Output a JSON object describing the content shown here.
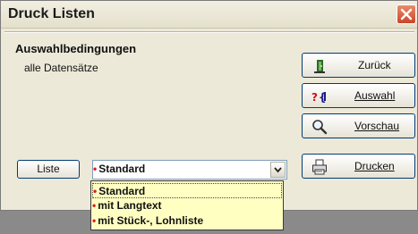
{
  "window": {
    "title": "Druck Listen"
  },
  "section": {
    "heading": "Auswahlbedingungen",
    "condition": "alle Datensätze"
  },
  "buttons": {
    "back": "Zurück",
    "select": "Auswahl",
    "preview": "Vorschau",
    "print": "Drucken",
    "liste": "Liste"
  },
  "combo": {
    "selected": "Standard"
  },
  "dropdown": {
    "options": [
      "Standard",
      "mit Langtext",
      "mit Stück-, Lohnliste"
    ]
  },
  "colors": {
    "bullet": "#e21a1a",
    "dropdown_bg": "#ffffc2",
    "close_button": "#c9462a"
  }
}
